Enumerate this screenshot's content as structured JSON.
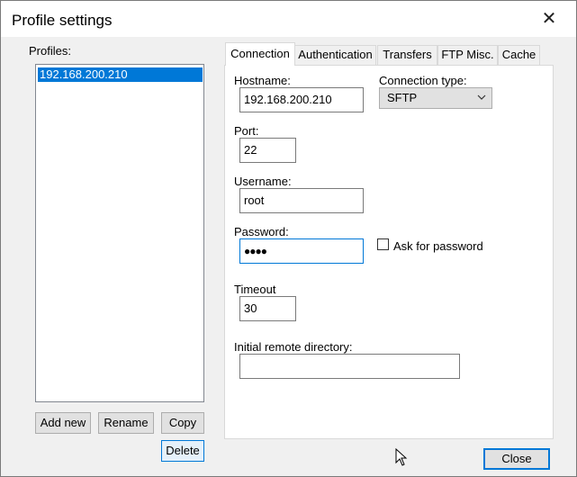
{
  "window": {
    "title": "Profile settings"
  },
  "profiles": {
    "label": "Profiles:",
    "items": [
      "192.168.200.210"
    ],
    "buttons": {
      "add": "Add new",
      "rename": "Rename",
      "copy": "Copy",
      "delete": "Delete"
    }
  },
  "tabs": [
    "Connection",
    "Authentication",
    "Transfers",
    "FTP Misc.",
    "Cache"
  ],
  "connection": {
    "hostname_label": "Hostname:",
    "hostname_value": "192.168.200.210",
    "type_label": "Connection type:",
    "type_value": "SFTP",
    "port_label": "Port:",
    "port_value": "22",
    "username_label": "Username:",
    "username_value": "root",
    "password_label": "Password:",
    "password_value": "●●●●",
    "ask_password_label": "Ask for password",
    "ask_password_checked": false,
    "timeout_label": "Timeout",
    "timeout_value": "30",
    "remote_dir_label": "Initial remote directory:",
    "remote_dir_value": ""
  },
  "footer": {
    "close": "Close"
  },
  "icons": {
    "close": "close-icon",
    "dropdown": "chevron-down-icon",
    "cursor": "mouse-pointer-icon"
  },
  "colors": {
    "selection": "#0078d7"
  }
}
